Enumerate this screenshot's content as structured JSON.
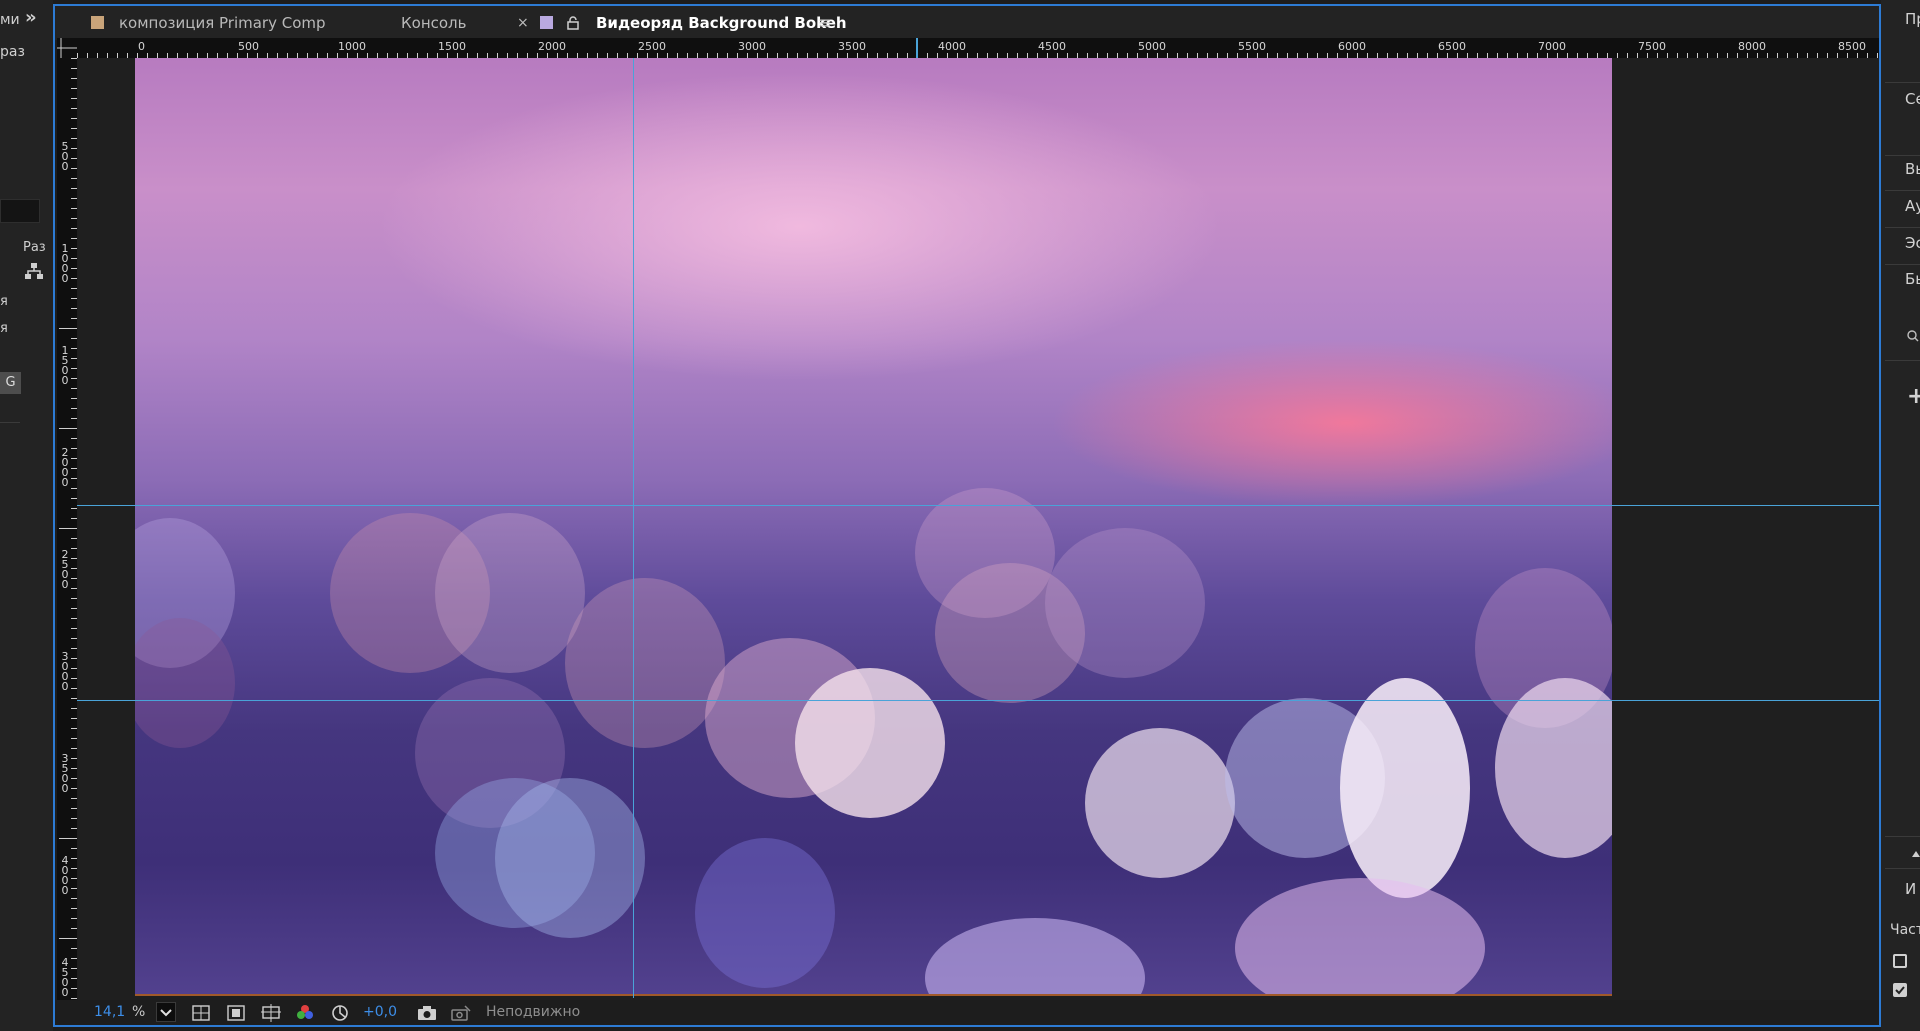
{
  "left_panel": {
    "fragments": [
      "ми",
      "раз",
      "Раз",
      "я",
      "я",
      "G"
    ],
    "expand_icon": "double-chevron-right"
  },
  "tabs": [
    {
      "label": "композиция Primary Comp",
      "color": "#c9a47a"
    },
    {
      "label": "Консоль"
    },
    {
      "label": "Видеоряд Background Bokeh",
      "color": "#b9a9e0",
      "active": true
    }
  ],
  "tab_close": "×",
  "tab_menu": "≡",
  "h_ruler": [
    "0",
    "500",
    "1000",
    "1500",
    "2000",
    "2500",
    "3000",
    "3500",
    "4000",
    "4500",
    "5000",
    "5500",
    "6000",
    "6500",
    "7000",
    "7500",
    "8000",
    "8500"
  ],
  "v_ruler": [
    "500",
    "1000",
    "1500",
    "2000",
    "2500",
    "3000",
    "3500",
    "4000",
    "4500"
  ],
  "bottom_bar": {
    "zoom_value": "14,1",
    "zoom_unit": "%",
    "exposure": "+0,0",
    "status": "Неподвижно"
  },
  "right_panel": {
    "fragments": [
      "Пр",
      "Се",
      "Вь",
      "Ау",
      "Эс",
      "Бь",
      "И",
      "Част"
    ]
  },
  "colors": {
    "accent": "#2d7bd4",
    "guide": "#4aa3d8",
    "zoom_blue": "#3d8ee8"
  }
}
